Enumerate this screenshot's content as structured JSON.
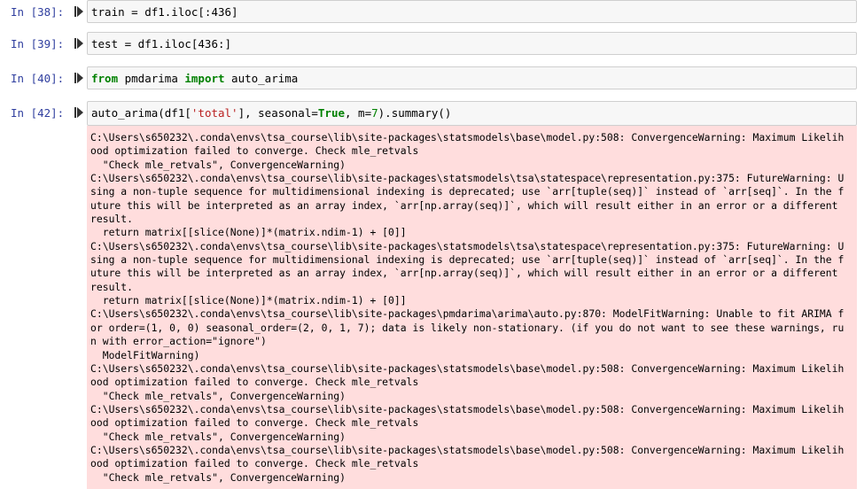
{
  "cells": [
    {
      "prompt": "In [38]:",
      "code": "train = df1.iloc[:436]"
    },
    {
      "prompt": "In [39]:",
      "code": "test = df1.iloc[436:]"
    },
    {
      "prompt": "In [40]:",
      "kw1": "from",
      "mid": " pmdarima ",
      "kw2": "import",
      "rest": " auto_arima"
    },
    {
      "prompt": "In [42]:",
      "c1": "auto_arima(df1[",
      "s1": "'total'",
      "c2": "], seasonal=",
      "k1": "True",
      "c3": ", m=",
      "n1": "7",
      "c4": ").summary()"
    }
  ],
  "output_lines": [
    "C:\\Users\\s650232\\.conda\\envs\\tsa_course\\lib\\site-packages\\statsmodels\\base\\model.py:508: ConvergenceWarning: Maximum Likelih",
    "ood optimization failed to converge. Check mle_retvals",
    "  \"Check mle_retvals\", ConvergenceWarning)",
    "C:\\Users\\s650232\\.conda\\envs\\tsa_course\\lib\\site-packages\\statsmodels\\tsa\\statespace\\representation.py:375: FutureWarning: U",
    "sing a non-tuple sequence for multidimensional indexing is deprecated; use `arr[tuple(seq)]` instead of `arr[seq]`. In the f",
    "uture this will be interpreted as an array index, `arr[np.array(seq)]`, which will result either in an error or a different",
    "result.",
    "  return matrix[[slice(None)]*(matrix.ndim-1) + [0]]",
    "C:\\Users\\s650232\\.conda\\envs\\tsa_course\\lib\\site-packages\\statsmodels\\tsa\\statespace\\representation.py:375: FutureWarning: U",
    "sing a non-tuple sequence for multidimensional indexing is deprecated; use `arr[tuple(seq)]` instead of `arr[seq]`. In the f",
    "uture this will be interpreted as an array index, `arr[np.array(seq)]`, which will result either in an error or a different",
    "result.",
    "  return matrix[[slice(None)]*(matrix.ndim-1) + [0]]",
    "C:\\Users\\s650232\\.conda\\envs\\tsa_course\\lib\\site-packages\\pmdarima\\arima\\auto.py:870: ModelFitWarning: Unable to fit ARIMA f",
    "or order=(1, 0, 0) seasonal_order=(2, 0, 1, 7); data is likely non-stationary. (if you do not want to see these warnings, ru",
    "n with error_action=\"ignore\")",
    "  ModelFitWarning)",
    "C:\\Users\\s650232\\.conda\\envs\\tsa_course\\lib\\site-packages\\statsmodels\\base\\model.py:508: ConvergenceWarning: Maximum Likelih",
    "ood optimization failed to converge. Check mle_retvals",
    "  \"Check mle_retvals\", ConvergenceWarning)",
    "C:\\Users\\s650232\\.conda\\envs\\tsa_course\\lib\\site-packages\\statsmodels\\base\\model.py:508: ConvergenceWarning: Maximum Likelih",
    "ood optimization failed to converge. Check mle_retvals",
    "  \"Check mle_retvals\", ConvergenceWarning)",
    "C:\\Users\\s650232\\.conda\\envs\\tsa_course\\lib\\site-packages\\statsmodels\\base\\model.py:508: ConvergenceWarning: Maximum Likelih",
    "ood optimization failed to converge. Check mle_retvals",
    "  \"Check mle_retvals\", ConvergenceWarning)"
  ]
}
